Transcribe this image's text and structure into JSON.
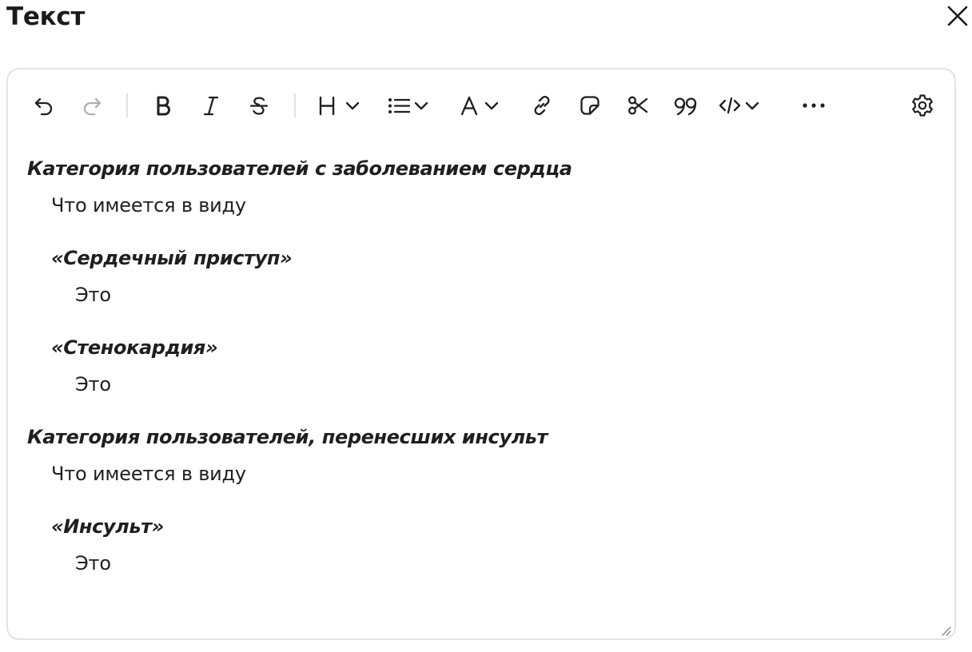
{
  "dialog": {
    "title": "Текст"
  },
  "toolbar": {
    "buttons": [
      {
        "id": "undo",
        "icon": "undo-icon",
        "enabled": true
      },
      {
        "id": "redo",
        "icon": "redo-icon",
        "enabled": false
      },
      {
        "id": "bold",
        "icon": "bold-icon",
        "enabled": true
      },
      {
        "id": "italic",
        "icon": "italic-icon",
        "enabled": true
      },
      {
        "id": "strikethrough",
        "icon": "strikethrough-icon",
        "enabled": true
      },
      {
        "id": "heading",
        "icon": "heading-icon",
        "enabled": true
      },
      {
        "id": "list",
        "icon": "list-icon",
        "enabled": true
      },
      {
        "id": "text-color",
        "icon": "text-color-icon",
        "enabled": true
      },
      {
        "id": "link",
        "icon": "link-icon",
        "enabled": true
      },
      {
        "id": "note",
        "icon": "note-icon",
        "enabled": true
      },
      {
        "id": "cut",
        "icon": "scissors-icon",
        "enabled": true
      },
      {
        "id": "quote",
        "icon": "quote-icon",
        "enabled": true
      },
      {
        "id": "code",
        "icon": "code-icon",
        "enabled": true
      },
      {
        "id": "more",
        "icon": "more-icon",
        "enabled": true
      },
      {
        "id": "settings",
        "icon": "gear-icon",
        "enabled": true
      }
    ],
    "heading_letter": "H",
    "color_letter": "A",
    "bold_letter": "B",
    "italic_letter": "I",
    "strike_letter": "S"
  },
  "content": {
    "lines": [
      {
        "type": "heading",
        "text": "Категория пользователей с заболеванием сердца"
      },
      {
        "type": "text",
        "text": "Что имеется в виду"
      },
      {
        "type": "heading",
        "text": "«Сердечный приступ»"
      },
      {
        "type": "text",
        "text": "Это"
      },
      {
        "type": "heading",
        "text": "«Стенокардия»"
      },
      {
        "type": "text",
        "text": "Это"
      },
      {
        "type": "heading",
        "text": "Категория пользователей, перенесших инсульт"
      },
      {
        "type": "text",
        "text": "Что имеется в виду"
      },
      {
        "type": "heading",
        "text": "«Инсульт»"
      },
      {
        "type": "text",
        "text": "Это"
      }
    ]
  },
  "colors": {
    "text": "#1f1f1f",
    "border": "#e4e4e4",
    "disabled_icon": "#b5b5b5"
  }
}
